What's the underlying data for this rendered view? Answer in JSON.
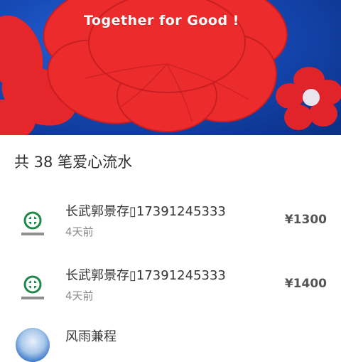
{
  "banner": {
    "tagline": "Together for Good !"
  },
  "summary": {
    "text": "共 38 笔爱心流水"
  },
  "donations": [
    {
      "name": "长武郭景存▯17391245333",
      "time": "4天前",
      "amount": "¥1300",
      "avatar": "hospital-logo-icon"
    },
    {
      "name": "长武郭景存▯17391245333",
      "time": "4天前",
      "amount": "¥1400",
      "avatar": "hospital-logo-icon"
    },
    {
      "name": "风雨兼程",
      "avatar": "sky-photo-avatar"
    }
  ],
  "colors": {
    "banner_blue": "#174bb8",
    "flower_red": "#e8242a",
    "text_primary": "#333333",
    "text_secondary": "#8a8a8a",
    "logo_green": "#1e8a4a"
  }
}
